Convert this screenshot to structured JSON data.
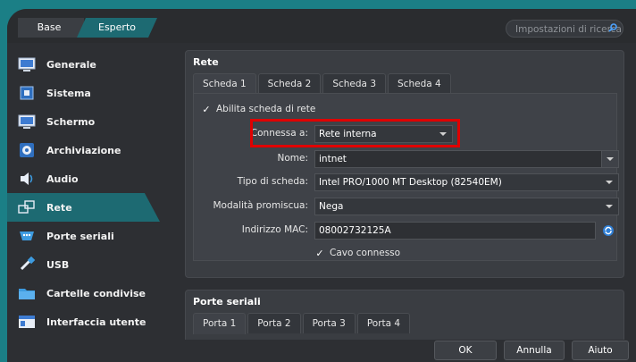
{
  "modes": {
    "base": "Base",
    "expert": "Esperto"
  },
  "search": {
    "placeholder": "Impostazioni di ricerca"
  },
  "sidebar": {
    "items": [
      {
        "label": "Generale",
        "icon": "monitor-icon"
      },
      {
        "label": "Sistema",
        "icon": "chip-icon"
      },
      {
        "label": "Schermo",
        "icon": "display-icon"
      },
      {
        "label": "Archiviazione",
        "icon": "disk-icon"
      },
      {
        "label": "Audio",
        "icon": "speaker-icon"
      },
      {
        "label": "Rete",
        "icon": "network-icon"
      },
      {
        "label": "Porte seriali",
        "icon": "serial-port-icon"
      },
      {
        "label": "USB",
        "icon": "usb-icon"
      },
      {
        "label": "Cartelle condivise",
        "icon": "folder-icon"
      },
      {
        "label": "Interfaccia utente",
        "icon": "window-icon"
      }
    ]
  },
  "network": {
    "title": "Rete",
    "tabs": [
      "Scheda 1",
      "Scheda 2",
      "Scheda 3",
      "Scheda 4"
    ],
    "enable_label": "Abilita scheda di rete",
    "attached_label": "Connessa a:",
    "attached_value": "Rete interna",
    "name_label": "Nome:",
    "name_value": "intnet",
    "adapter_label": "Tipo di scheda:",
    "adapter_value": "Intel PRO/1000 MT Desktop (82540EM)",
    "promisc_label": "Modalità promiscua:",
    "promisc_value": "Nega",
    "mac_label": "Indirizzo MAC:",
    "mac_value": "08002732125A",
    "cable_label": "Cavo connesso"
  },
  "serial": {
    "title": "Porte seriali",
    "tabs": [
      "Porta 1",
      "Porta 2",
      "Porta 3",
      "Porta 4"
    ]
  },
  "buttons": {
    "ok": "OK",
    "cancel": "Annulla",
    "help": "Aiuto"
  },
  "colors": {
    "accent": "#1d6a72",
    "highlight": "#e00000"
  }
}
